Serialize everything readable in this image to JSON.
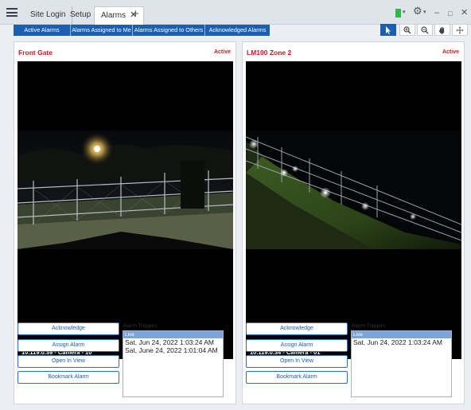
{
  "tabs": [
    {
      "label": "Site Login"
    },
    {
      "label": "Setup"
    },
    {
      "label": "Alarms",
      "active": true,
      "close": "✕"
    }
  ],
  "tab_add": "+",
  "window_controls": {
    "minimize": "–",
    "maximize": "□",
    "close": "✕"
  },
  "status_color": "#2db84a",
  "filters": [
    {
      "label": "Active Alarms"
    },
    {
      "label": "Alarms Assigned to Me"
    },
    {
      "label": "Alarms Assigned to Others"
    },
    {
      "label": "Acknowledged Alarms"
    }
  ],
  "tools": [
    {
      "icon": "pointer-icon",
      "selected": true
    },
    {
      "icon": "zoom-in-icon"
    },
    {
      "icon": "zoom-out-icon"
    },
    {
      "icon": "pan-hand-icon"
    },
    {
      "icon": "move-icon"
    }
  ],
  "panels": [
    {
      "title": "Front Gate",
      "status": "Active",
      "camera_label": "10.119.0.39 - Camera - 10",
      "buttons": {
        "acknowledge": "Acknowledge",
        "assign": "Assign Alarm",
        "open_view": "Open In View",
        "bookmark": "Bookmark Alarm"
      },
      "triggers_title": "Alarm Triggers",
      "triggers_header": "Live",
      "triggers": [
        "Sat, Jun 24, 2022 1:03:24 AM",
        "Sat, June 24, 2022 1:01:04 AM"
      ]
    },
    {
      "title": "LM100 Zone 2",
      "status": "Active",
      "camera_label": "10.119.0.34 - Camera - 01",
      "buttons": {
        "acknowledge": "Acknowledge",
        "assign": "Assign Alarm",
        "open_view": "Open In View",
        "bookmark": "Bookmark Alarm"
      },
      "triggers_title": "Alarm Triggers",
      "triggers_header": "Live",
      "triggers": [
        "Sat, Jun 24, 2022 1:03:24 AM"
      ]
    }
  ],
  "colors": {
    "accent": "#1c5fb0",
    "alarm_red": "#c81a20",
    "status_green": "#2db84a"
  }
}
